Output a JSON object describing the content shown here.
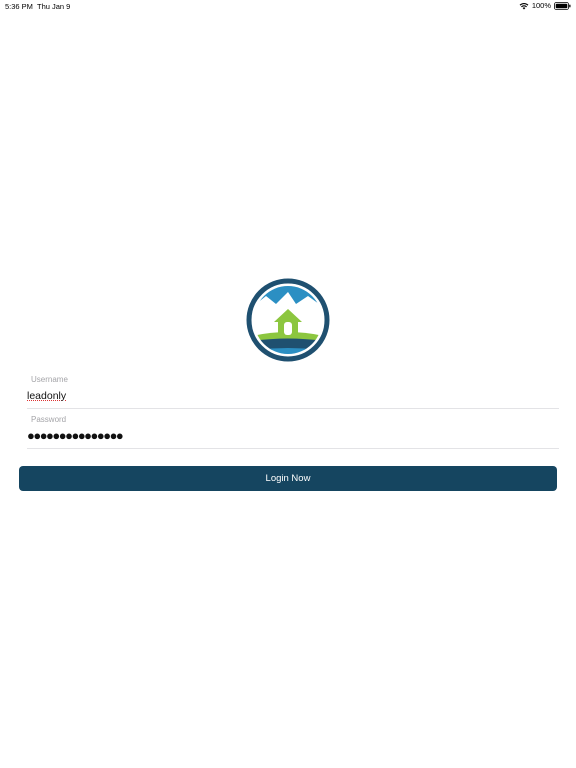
{
  "status_bar": {
    "time": "5:36 PM",
    "date": "Thu Jan 9",
    "battery": "100%",
    "wifi_icon": "wifi-icon",
    "battery_icon": "battery-icon"
  },
  "logo": {
    "icon": "house-mountain-logo",
    "colors": {
      "ring": "#1f5070",
      "sky": "#2b8fc3",
      "house": "#8cc63f",
      "water": "#1f5070"
    }
  },
  "form": {
    "username": {
      "label": "Username",
      "value": "leadonly"
    },
    "password": {
      "label": "Password",
      "value": "●●●●●●●●●●●●●●●"
    },
    "login_label": "Login Now"
  },
  "colors": {
    "accent": "#154560",
    "label": "#a4a4a8",
    "divider": "#e3e3e6"
  }
}
